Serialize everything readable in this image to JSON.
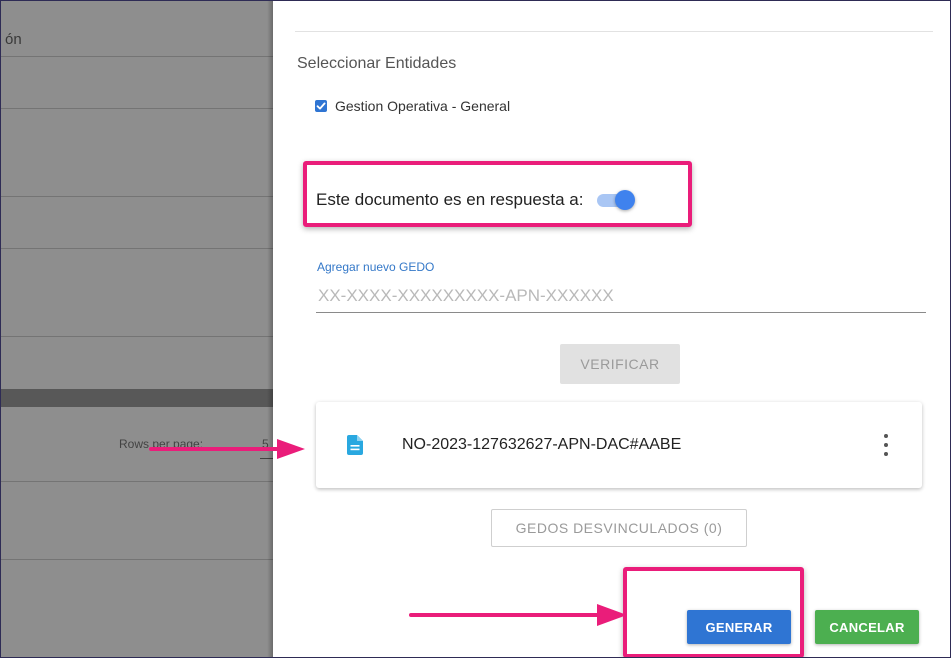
{
  "background_page": {
    "header_fragment": "ón",
    "rows_per_page_label": "Rows per page:",
    "rows_per_page_value": "5"
  },
  "drawer": {
    "section_title": "Seleccionar Entidades",
    "entities": [
      {
        "label": "Gestion Operativa - General",
        "checked": true
      }
    ],
    "response_toggle": {
      "label": "Este documento es en respuesta a:",
      "on": true
    },
    "gedo_field": {
      "label": "Agregar nuevo GEDO",
      "placeholder": "XX-XXXX-XXXXXXXXX-APN-XXXXXX",
      "value": ""
    },
    "verify_button": "VERIFICAR",
    "linked_document": {
      "icon": "document-icon",
      "title": "NO-2023-127632627-APN-DAC#AABE",
      "menu_icon": "more-vertical-icon"
    },
    "unlinked_button": "GEDOS DESVINCULADOS (0)",
    "generate_button": "GENERAR",
    "cancel_button": "CANCELAR"
  },
  "colors": {
    "primary": "#2f75d3",
    "success": "#4caf50",
    "annotation": "#ea1d7a",
    "doc_icon": "#29a8e0"
  }
}
